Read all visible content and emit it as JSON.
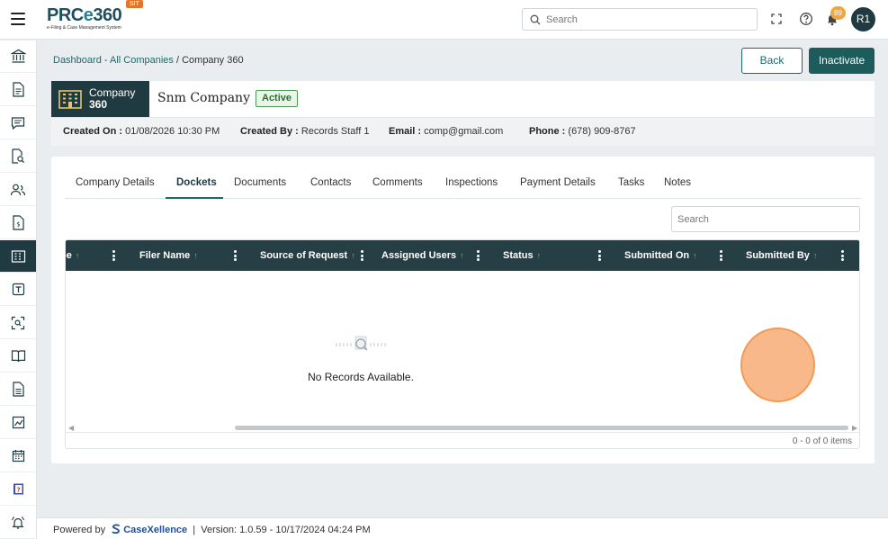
{
  "header": {
    "logo_text": "PRCe360",
    "logo_subtitle": "e-Filing & Case Management System",
    "env_badge": "SIT",
    "search_placeholder": "Search",
    "notification_count": "89",
    "avatar_initials": "R1"
  },
  "sidebar": {
    "items": [
      {
        "icon": "institution-icon"
      },
      {
        "icon": "document-icon"
      },
      {
        "icon": "chat-icon"
      },
      {
        "icon": "document-search-icon"
      },
      {
        "icon": "users-icon"
      },
      {
        "icon": "invoice-icon"
      },
      {
        "icon": "company-building-icon",
        "active": true
      },
      {
        "icon": "template-icon"
      },
      {
        "icon": "scan-search-icon"
      },
      {
        "icon": "book-icon"
      },
      {
        "icon": "file-icon"
      },
      {
        "icon": "chart-icon"
      },
      {
        "icon": "calendar-icon"
      },
      {
        "icon": "help-book-icon"
      },
      {
        "icon": "bell-alert-icon"
      }
    ]
  },
  "breadcrumb": {
    "dashboard": "Dashboard",
    "separator1": " - ",
    "all_companies": "All Companies",
    "separator2": " / ",
    "current": "Company 360"
  },
  "actions": {
    "back_label": "Back",
    "inactivate_label": "Inactivate"
  },
  "company": {
    "tag_line1": "Company",
    "tag_line2": "360",
    "name": "Snm Company",
    "status": "Active"
  },
  "meta": {
    "created_on_label": "Created On :",
    "created_on_value": "01/08/2026 10:30 PM",
    "created_by_label": "Created By :",
    "created_by_value": "Records Staff 1",
    "email_label": "Email :",
    "email_value": "comp@gmail.com",
    "phone_label": "Phone :",
    "phone_value": "(678) 909-8767"
  },
  "tabs": [
    "Company Details",
    "Dockets",
    "Documents",
    "Contacts",
    "Comments",
    "Inspections",
    "Payment Details",
    "Tasks",
    "Notes"
  ],
  "active_tab": "Dockets",
  "grid": {
    "search_placeholder": "Search",
    "columns": [
      "pe",
      "Filer Name",
      "Source of Request",
      "Assigned Users",
      "Status",
      "Submitted On",
      "Submitted By"
    ],
    "empty_message": "No Records Available.",
    "pager_text": "0 - 0 of 0 items"
  },
  "footer": {
    "powered_by": "Powered by",
    "brand": "CaseXellence",
    "separator": "|",
    "version": "Version: 1.0.59 - 10/17/2024 04:24 PM"
  },
  "colors": {
    "primary_dark": "#1f3a40",
    "accent_teal": "#1c6a6a",
    "active_green": "#2f6d33",
    "badge_orange": "#f0a640"
  }
}
